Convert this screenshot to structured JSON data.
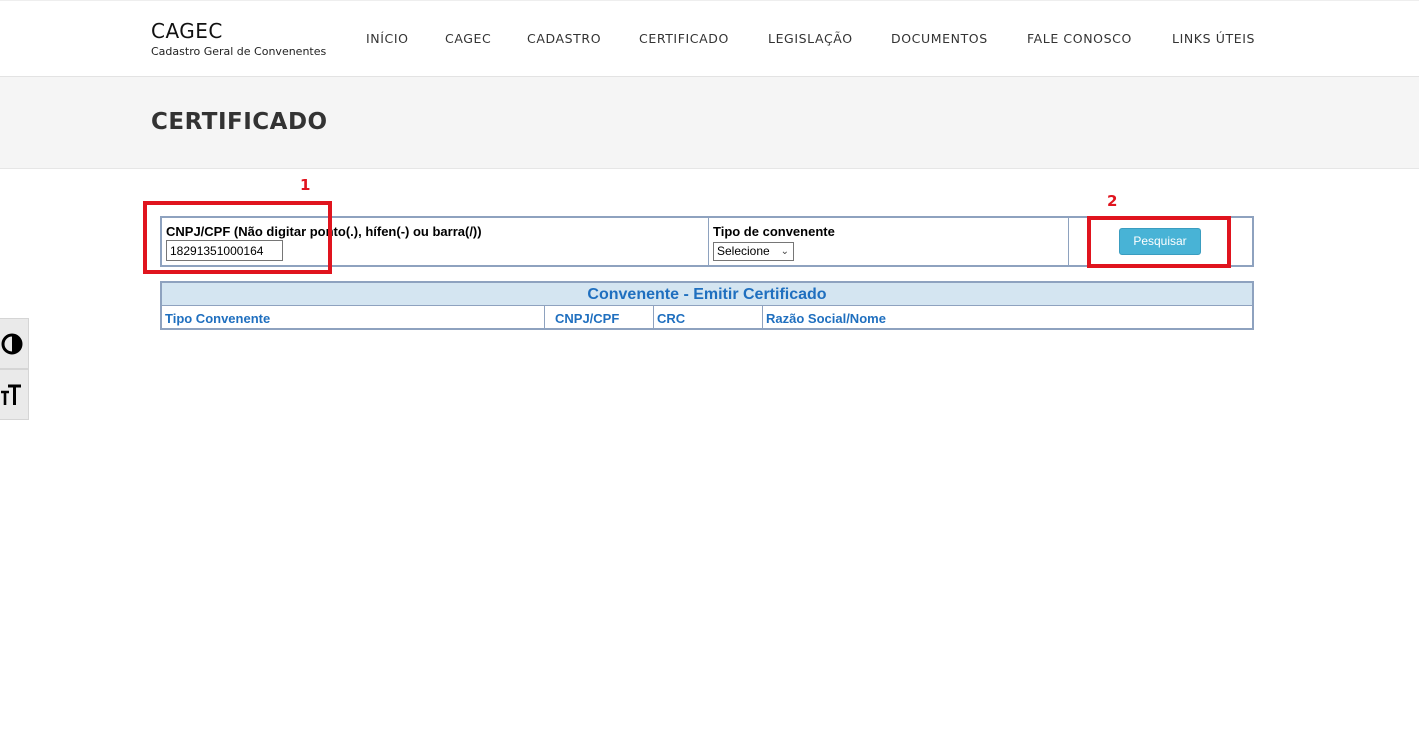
{
  "header": {
    "brand_title": "CAGEC",
    "brand_subtitle": "Cadastro Geral de Convenentes",
    "nav": [
      "INÍCIO",
      "CAGEC",
      "CADASTRO",
      "CERTIFICADO",
      "LEGISLAÇÃO",
      "DOCUMENTOS",
      "FALE CONOSCO",
      "LINKS ÚTEIS"
    ]
  },
  "page_title": "CERTIFICADO",
  "search_form": {
    "cnpj_label": "CNPJ/CPF (Não digitar ponto(.), hífen(-) ou barra(/))",
    "cnpj_value": "18291351000164",
    "tipo_label": "Tipo de convenente",
    "tipo_selected": "Selecione",
    "search_button": "Pesquisar"
  },
  "results": {
    "title": "Convenente - Emitir Certificado",
    "columns": [
      "Tipo Convenente",
      "CNPJ/CPF",
      "CRC",
      "Razão Social/Nome"
    ]
  },
  "annotations": {
    "marker_1": "1",
    "marker_2": "2",
    "color": "#e0141e"
  },
  "accessibility": {
    "contrast_icon": "contrast-icon",
    "font_size_icon": "font-size-icon"
  }
}
